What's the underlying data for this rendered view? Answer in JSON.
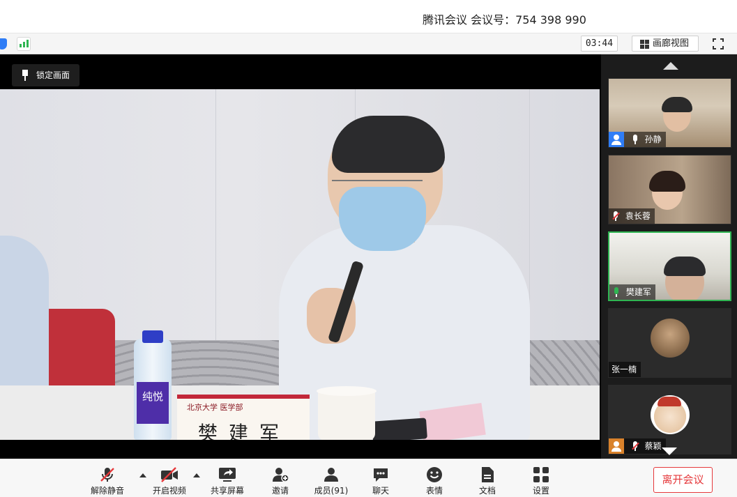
{
  "window": {
    "title": "腾讯会议 会议号：754 398 990"
  },
  "toolbar": {
    "timer": "03:44",
    "gallery_view_label": "画廊视图"
  },
  "stage": {
    "lock_screen_label": "锁定画面",
    "nameplate_logo": "北京大学 医学部",
    "nameplate_name": "樊建军",
    "bottle_label": "纯悦"
  },
  "participants": [
    {
      "name": "孙静",
      "mic": "on",
      "badge": "user"
    },
    {
      "name": "袁长蓉",
      "mic": "muted",
      "badge": "none"
    },
    {
      "name": "樊建军",
      "mic": "speaking",
      "badge": "none",
      "active": true
    },
    {
      "name": "张一楠",
      "mic": "none",
      "badge": "none"
    },
    {
      "name": "蔡颖",
      "mic": "muted",
      "badge": "user"
    }
  ],
  "bottombar": {
    "unmute": "解除静音",
    "start_video": "开启视频",
    "share_screen": "共享屏幕",
    "invite": "邀请",
    "members": "成员(91)",
    "chat": "聊天",
    "reactions": "表情",
    "documents": "文档",
    "settings": "设置",
    "leave": "离开会议"
  },
  "colors": {
    "accent_blue": "#2f7df6",
    "speaking_green": "#2fb552",
    "danger_red": "#e5383b",
    "rail_bg": "#1c1c1c"
  }
}
